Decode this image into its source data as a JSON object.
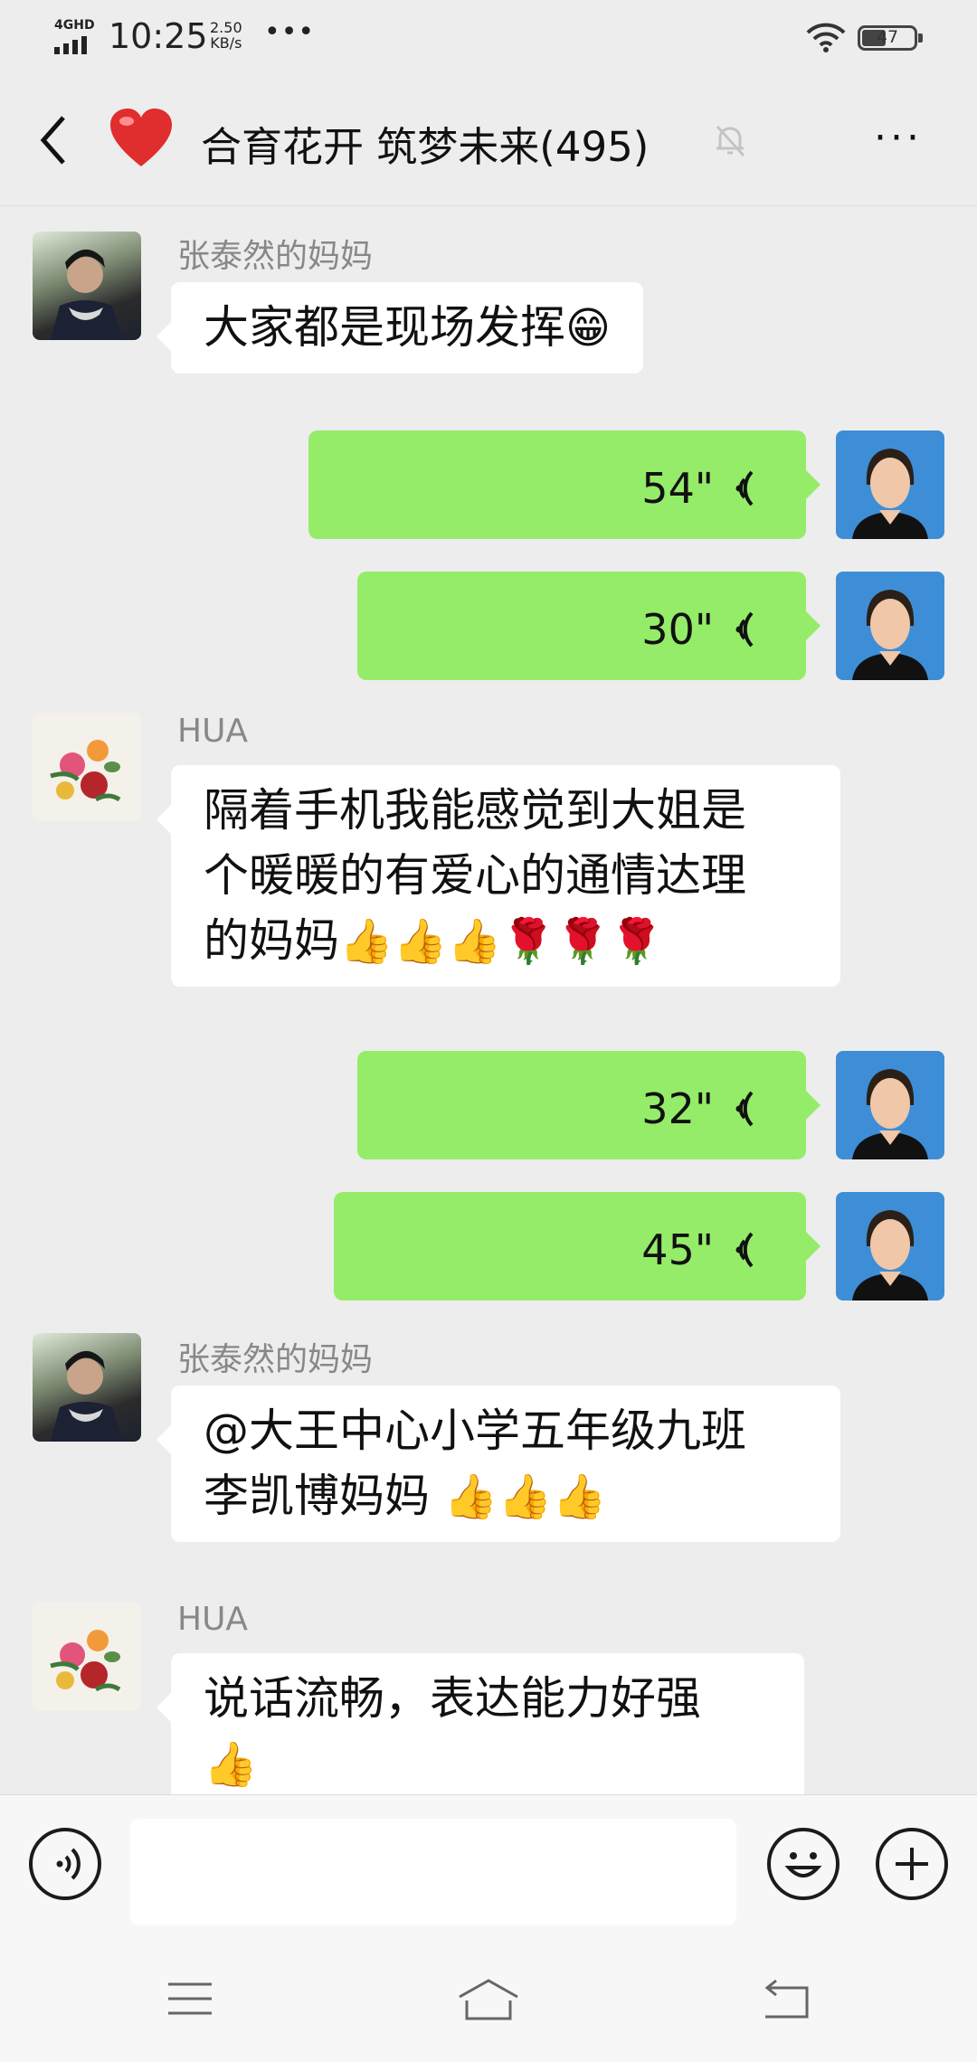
{
  "status_bar": {
    "network": "4GHD",
    "time": "10:25",
    "speed_value": "2.50",
    "speed_unit": "KB/s",
    "more": "•••",
    "battery": "47"
  },
  "header": {
    "title": "合育花开 筑梦未来(495)",
    "heart_color": "#e02d2d"
  },
  "messages": [
    {
      "sender": "张泰然的妈妈",
      "text": "大家都是现场发挥",
      "emoji": "😁"
    },
    {
      "duration": "54\""
    },
    {
      "duration": "30\""
    },
    {
      "sender": "HUA",
      "line1": "隔着手机我能感觉到大姐是",
      "line2": "个暖暖的有爱心的通情达理",
      "line3": "的妈妈",
      "emoji": "👍👍👍🌹🌹🌹"
    },
    {
      "duration": "32\""
    },
    {
      "duration": "45\""
    },
    {
      "sender": "张泰然的妈妈",
      "line1": "@大王中心小学五年级九班",
      "line2": "李凯博妈妈",
      "emoji": "👍👍👍"
    },
    {
      "sender": "HUA",
      "line1": "说话流畅，表达能力好强",
      "emoji": "👍"
    }
  ],
  "input": {
    "placeholder": ""
  },
  "colors": {
    "self_bubble": "#95ec69",
    "other_bubble": "#ffffff",
    "background": "#ededed"
  }
}
